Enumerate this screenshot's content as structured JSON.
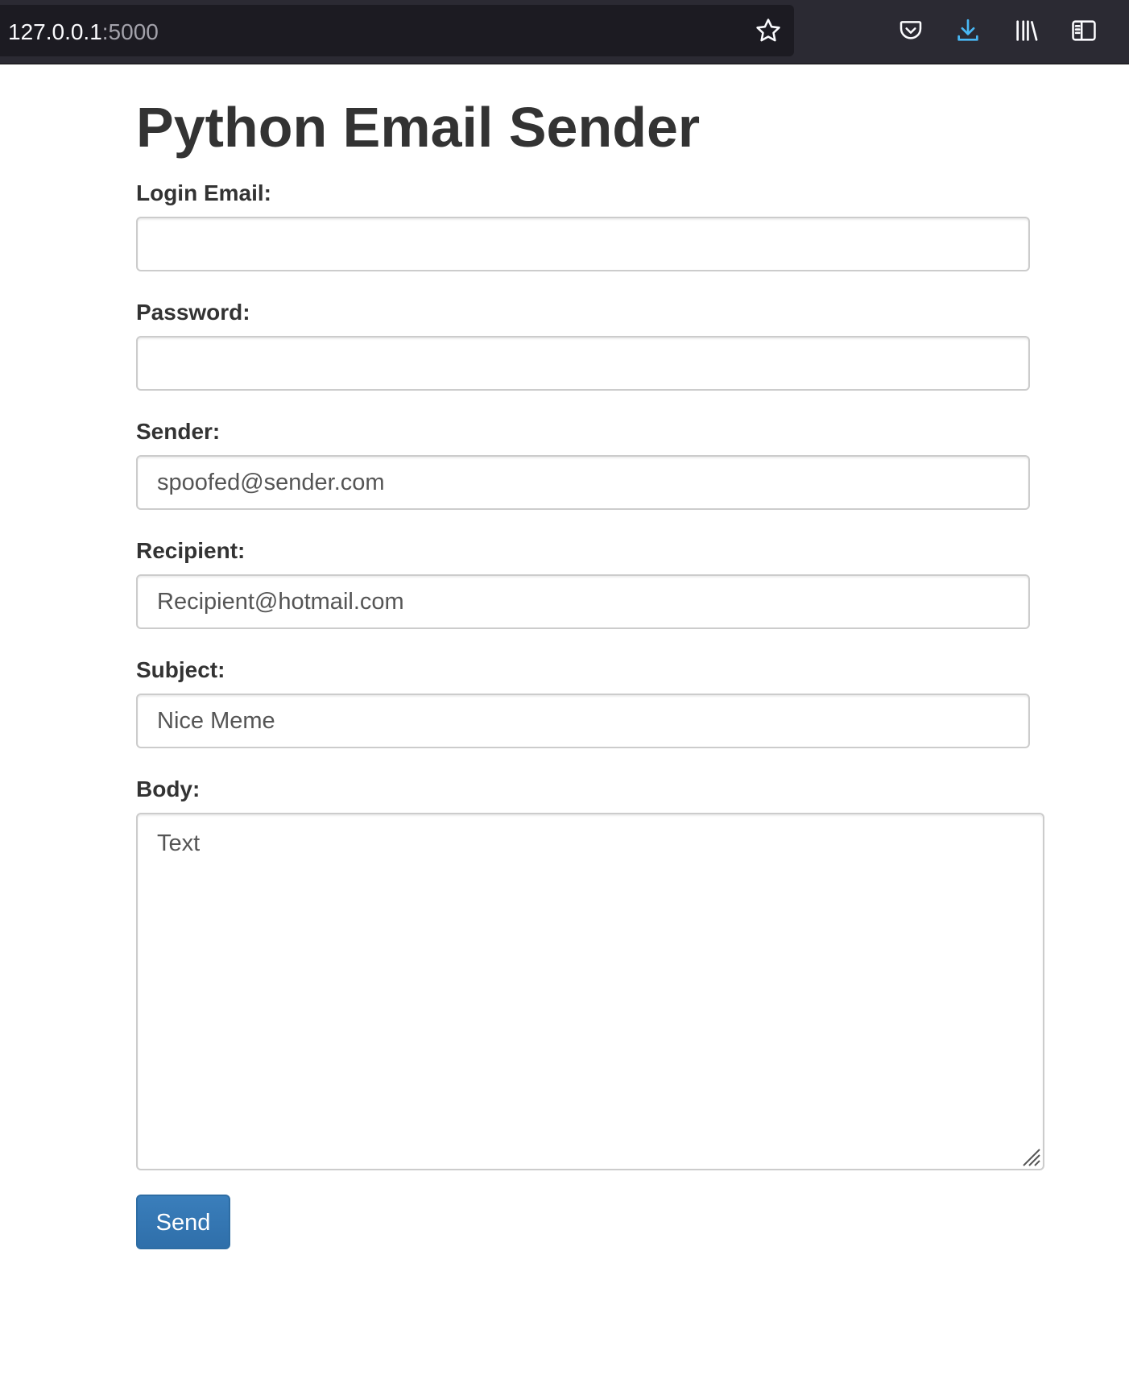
{
  "browser": {
    "url_host": "127.0.0.1",
    "url_port": ":5000",
    "icons": [
      "star-icon",
      "pocket-icon",
      "download-icon",
      "library-icon",
      "sidebar-icon"
    ],
    "download_color": "#54ffbd"
  },
  "page": {
    "title": "Python Email Sender"
  },
  "form": {
    "login_email": {
      "label": "Login Email:",
      "value": ""
    },
    "password": {
      "label": "Password:",
      "value": ""
    },
    "sender": {
      "label": "Sender:",
      "value": "spoofed@sender.com"
    },
    "recipient": {
      "label": "Recipient:",
      "value": "Recipient@hotmail.com"
    },
    "subject": {
      "label": "Subject:",
      "value": "Nice Meme"
    },
    "body": {
      "label": "Body:",
      "value": "Text"
    },
    "send_label": "Send",
    "button_color": "#337ab7"
  }
}
